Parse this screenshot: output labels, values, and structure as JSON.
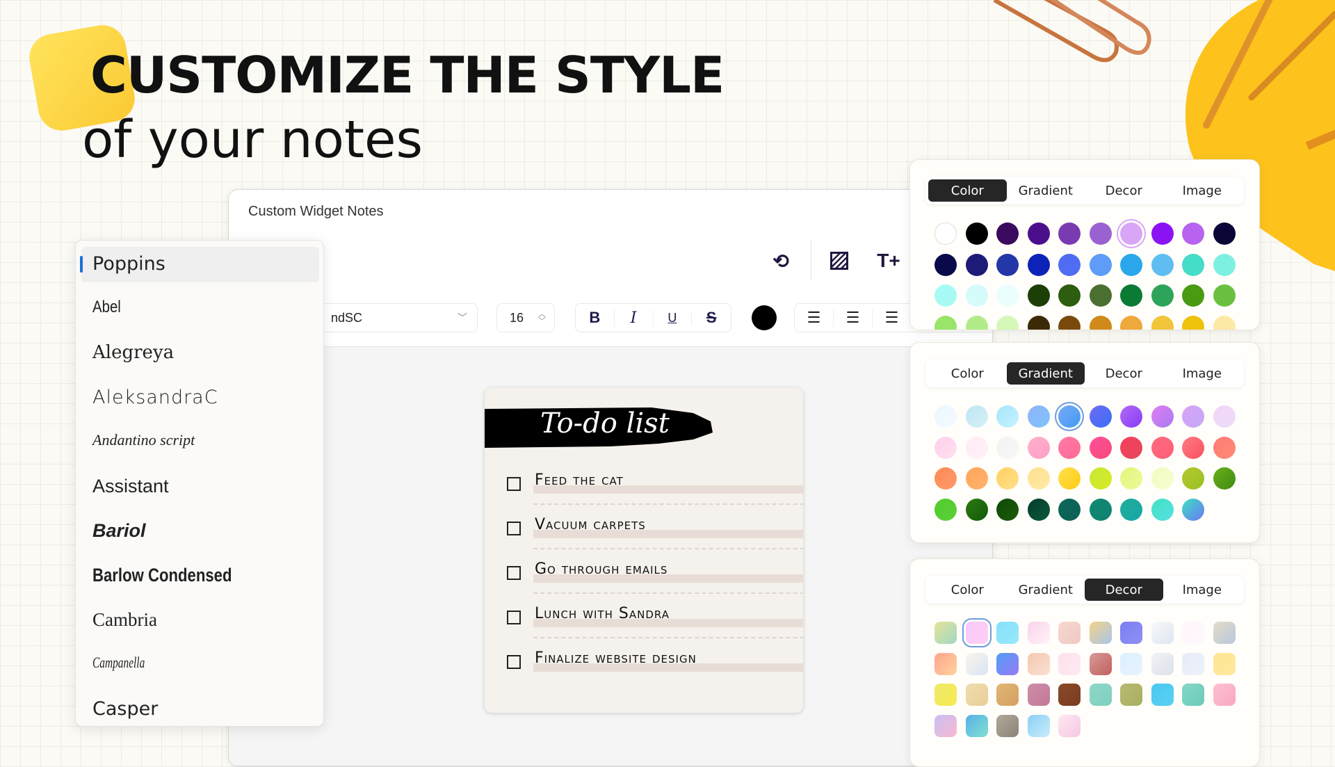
{
  "headline": {
    "line1": "CUSTOMIZE THE STYLE",
    "line2": "of your notes"
  },
  "accent_yellow": "#fbc933",
  "window": {
    "title": "Custom Widget Notes",
    "icons": [
      "undo-icon",
      "pattern-icon",
      "text-add-icon"
    ],
    "toolbar": {
      "font_value": "ndSC",
      "font_size": "16",
      "bold": "B",
      "italic": "I",
      "underline": "U",
      "strike": "S",
      "text_color": "#000000",
      "align": [
        "left",
        "center",
        "right"
      ]
    }
  },
  "font_list": {
    "selected": "Poppins",
    "items": [
      "Poppins",
      "Abel",
      "Alegreya",
      "AleksandraC",
      "Andantino script",
      "Assistant",
      "Bariol",
      "Barlow Condensed",
      "Cambria",
      "Campanella",
      "Casper"
    ]
  },
  "note": {
    "title": "To-do list",
    "items": [
      "Feed the cat",
      "Vacuum carpets",
      "Go through emails",
      "Lunch with Sandra",
      "Finalize website design"
    ]
  },
  "panels": [
    {
      "tabs": [
        "Color",
        "Gradient",
        "Decor",
        "Image"
      ],
      "active": "Color",
      "selected_index": 6,
      "swatches": [
        "#ffffff",
        "#000000",
        "#3a0a5e",
        "#4c0f8c",
        "#7a3bb0",
        "#9a62d0",
        "#d9a6f7",
        "#8a12f3",
        "#b763f0",
        "#0a0738",
        "#0a0a4a",
        "#1e1a78",
        "#2337a8",
        "#0d23b8",
        "#4f6cf2",
        "#5e9cf7",
        "#2aa7ea",
        "#5fbdf2",
        "#45dcc8",
        "#7ef0e2",
        "#a8fbf4",
        "#d5fbfa",
        "#eafefd",
        "#1c3f08",
        "#2d5d0f",
        "#4b6f30",
        "#0b7a35",
        "#2ea45a",
        "#4a9a12",
        "#6cc040",
        "#9be46a",
        "#b2ec8a",
        "#d5f7b8",
        "#3b2a05",
        "#7a4a0d",
        "#d08a1a",
        "#efa83a",
        "#f2c53a",
        "#efc20c",
        "#fde9a6"
      ]
    },
    {
      "tabs": [
        "Color",
        "Gradient",
        "Decor",
        "Image"
      ],
      "active": "Gradient",
      "selected_index": 4,
      "swatches": [
        [
          "#eaf6ff",
          "#f5fbff"
        ],
        [
          "#bde6f2",
          "#d6f0f7"
        ],
        [
          "#a5e6fb",
          "#c7f2ff"
        ],
        [
          "#8fb2fb",
          "#7fc4fb"
        ],
        [
          "#7aa8f5",
          "#3e9cf7"
        ],
        [
          "#6e6cf5",
          "#3a6df5"
        ],
        [
          "#b06bf5",
          "#8a3af7"
        ],
        [
          "#e07cf3",
          "#a97cf3"
        ],
        [
          "#d7a3f5",
          "#c6a8f9"
        ],
        [
          "#f1d5fa",
          "#ecdcfb"
        ],
        [
          "#ffd0ea",
          "#ffe0f0"
        ],
        [
          "#ffeaf5",
          "#fff2f8"
        ],
        [
          "#f2f2f2",
          "#f7f7f7"
        ],
        [
          "#ffb0cc",
          "#ff9fc8"
        ],
        [
          "#ff7aa8",
          "#ff6a93"
        ],
        [
          "#ff4f9a",
          "#f74a7a"
        ],
        [
          "#f2405e",
          "#e8485a"
        ],
        [
          "#ff6b80",
          "#ff5e77"
        ],
        [
          "#ff7a85",
          "#f7525e"
        ],
        [
          "#ff7b73",
          "#ff8a76"
        ],
        [
          "#ff8a55",
          "#ff9a6a"
        ],
        [
          "#ffa45c",
          "#ffb36b"
        ],
        [
          "#ffd060",
          "#ffe08a"
        ],
        [
          "#ffe08f",
          "#ffeaa8"
        ],
        [
          "#ffe050",
          "#ffcc10"
        ],
        [
          "#c8e83a",
          "#d6ea20"
        ],
        [
          "#e2f77a",
          "#eef89a"
        ],
        [
          "#f2fcbf",
          "#f6fdd0"
        ],
        [
          "#b5c932",
          "#9ac020"
        ],
        [
          "#6ab01a",
          "#3f8a12"
        ],
        [
          "#4fcd2a",
          "#5ccf3a"
        ],
        [
          "#2b7a12",
          "#135a08"
        ],
        [
          "#0e4a05",
          "#1d5a0e"
        ],
        [
          "#043a2e",
          "#0b5a3a"
        ],
        [
          "#0b6a5a",
          "#0d5e55"
        ],
        [
          "#0f8a74",
          "#128070"
        ],
        [
          "#21ae9a",
          "#15a6a8"
        ],
        [
          "#43e2c0",
          "#55e0e6"
        ],
        [
          "#3ee0c2",
          "#6a78f5"
        ]
      ]
    },
    {
      "tabs": [
        "Color",
        "Gradient",
        "Decor",
        "Image"
      ],
      "active": "Decor",
      "selected_index": 1,
      "swatches": [
        [
          "#e8e39a",
          "#9fd8c2"
        ],
        [
          "#f5c8f8",
          "#ffd0f5"
        ],
        [
          "#86e0fa",
          "#98e8fb"
        ],
        [
          "#fbd3ea",
          "#fff2f8"
        ],
        [
          "#f7d8d0",
          "#f0c8c4"
        ],
        [
          "#f4d28a",
          "#a8c5e8"
        ],
        [
          "#7a7ef2",
          "#8f8ff5"
        ],
        [
          "#f8f8fa",
          "#dde6f0"
        ],
        [
          "#fdf5fb",
          "#fff8fc"
        ],
        [
          "#e4dcc8",
          "#b8c8dc"
        ],
        [
          "#ffa390",
          "#ffd39a"
        ],
        [
          "#fbf5ea",
          "#d8e4f5"
        ],
        [
          "#4f9df5",
          "#9a7af7"
        ],
        [
          "#f6c8b0",
          "#f8e0d2"
        ],
        [
          "#fde0ec",
          "#fdeaf2"
        ],
        [
          "#d99a98",
          "#c0605e"
        ],
        [
          "#dcefff",
          "#e8f4ff"
        ],
        [
          "#f0f2f5",
          "#dde2ea"
        ],
        [
          "#e6ebf8",
          "#eef2fb"
        ],
        [
          "#ffe592",
          "#ffe9a0"
        ],
        [
          "#f0e86a",
          "#f5ec50"
        ],
        [
          "#efdcae",
          "#e8cf98"
        ],
        [
          "#e2b676",
          "#d4a060"
        ],
        [
          "#cf8ea8",
          "#c07898"
        ],
        [
          "#8a4a2a",
          "#7a3b20"
        ],
        [
          "#8fd8c8",
          "#7ecfbf"
        ],
        [
          "#b8b872",
          "#a8b060"
        ],
        [
          "#4ac8ee",
          "#5ad0f5"
        ],
        [
          "#86d8c8",
          "#6acab8"
        ],
        [
          "#ffbfd0",
          "#f8a8c0"
        ],
        [
          "#c8c0f5",
          "#f8b8d0"
        ],
        [
          "#58b0e8",
          "#80e0d0"
        ],
        [
          "#b0a898",
          "#8c8478"
        ],
        [
          "#8cd0f5",
          "#c8ecfb"
        ],
        [
          "#fde8f3",
          "#f5c8e0"
        ]
      ]
    }
  ]
}
